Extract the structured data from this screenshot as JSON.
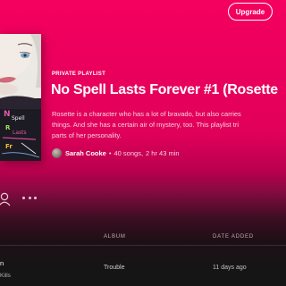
{
  "header": {
    "upgrade_label": "Upgrade"
  },
  "playlist": {
    "type_label": "PRIVATE PLAYLIST",
    "title": "No Spell Lasts Forever #1 (Rosette",
    "description_lines": [
      "Rosette is a character who has a lot of bravado, but also carries",
      "things. And she has a certain air of mystery, too. This playlist tri",
      "parts of her personality."
    ],
    "owner": "Sarah Cooke",
    "separator": "•",
    "songs": "40 songs,",
    "duration": "2 hr 43 min"
  },
  "table": {
    "header": {
      "album": "ALBUM",
      "date_added": "DATE ADDED"
    },
    "rows": [
      {
        "title": "n",
        "artist": "Kills",
        "album": "Trouble",
        "date_added": "11 days ago"
      }
    ]
  },
  "colors": {
    "accent": "#f5005f",
    "background": "#151515"
  },
  "icons": {
    "profile": "person-outline-icon",
    "more": "more-dots-icon"
  }
}
